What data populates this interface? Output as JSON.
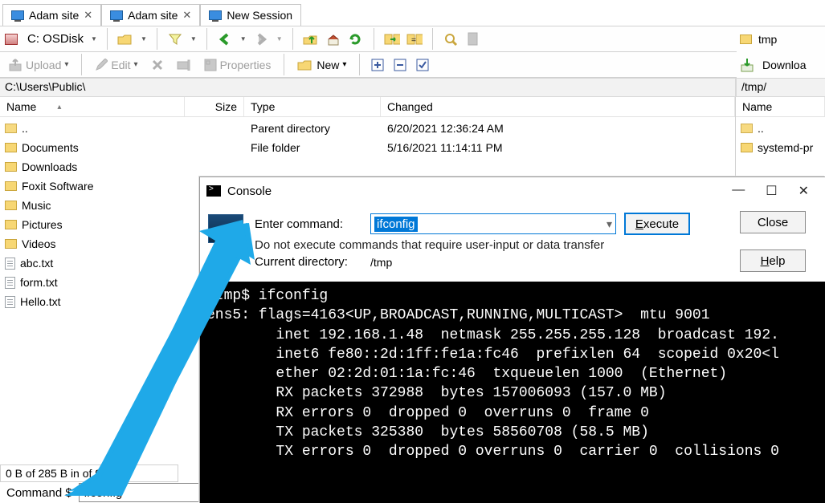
{
  "tabs": [
    {
      "label": "Adam site",
      "has_close": true
    },
    {
      "label": "Adam site",
      "has_close": true
    },
    {
      "label": "New Session",
      "has_close": false
    }
  ],
  "disk": {
    "label": "C: OSDisk"
  },
  "toolbar2": {
    "upload": "Upload",
    "edit": "Edit",
    "properties": "Properties",
    "newlbl": "New"
  },
  "left": {
    "path": "C:\\Users\\Public\\",
    "cols": {
      "name": "Name",
      "size": "Size",
      "type": "Type",
      "changed": "Changed"
    },
    "entries": [
      {
        "name": "..",
        "kind": "up",
        "type": "Parent directory",
        "changed": "6/20/2021  12:36:24 AM"
      },
      {
        "name": "Documents",
        "kind": "folder",
        "type": "File folder",
        "changed": "5/16/2021  11:14:11 PM"
      },
      {
        "name": "Downloads",
        "kind": "folder"
      },
      {
        "name": "Foxit Software",
        "kind": "folder"
      },
      {
        "name": "Music",
        "kind": "folder"
      },
      {
        "name": "Pictures",
        "kind": "folder"
      },
      {
        "name": "Videos",
        "kind": "folder"
      },
      {
        "name": "abc.txt",
        "kind": "file"
      },
      {
        "name": "form.txt",
        "kind": "file"
      },
      {
        "name": "Hello.txt",
        "kind": "file"
      }
    ],
    "status": "0 B of 285 B in    of 9"
  },
  "right": {
    "tmp_label": "tmp",
    "download_label": "Downloa",
    "path": "/tmp/",
    "name_col": "Name",
    "entries": [
      {
        "name": "..",
        "kind": "up"
      },
      {
        "name": "systemd-pr",
        "kind": "folder"
      }
    ]
  },
  "cmd": {
    "label": "Command $",
    "value": "ifconfig"
  },
  "console": {
    "title": "Console",
    "enter_label": "Enter command:",
    "value": "ifconfig",
    "execute": "Execute",
    "close": "Close",
    "help": "Help",
    "hint": "Do not execute commands that require user-input or data transfer",
    "cwd_label": "Current directory:",
    "cwd_value": "/tmp",
    "output": "/tmp$ ifconfig\nens5: flags=4163<UP,BROADCAST,RUNNING,MULTICAST>  mtu 9001\n        inet 192.168.1.48  netmask 255.255.255.128  broadcast 192.\n        inet6 fe80::2d:1ff:fe1a:fc46  prefixlen 64  scopeid 0x20<l\n        ether 02:2d:01:1a:fc:46  txqueuelen 1000  (Ethernet)\n        RX packets 372988  bytes 157006093 (157.0 MB)\n        RX errors 0  dropped 0  overruns 0  frame 0\n        TX packets 325380  bytes 58560708 (58.5 MB)\n        TX errors 0  dropped 0 overruns 0  carrier 0  collisions 0"
  }
}
